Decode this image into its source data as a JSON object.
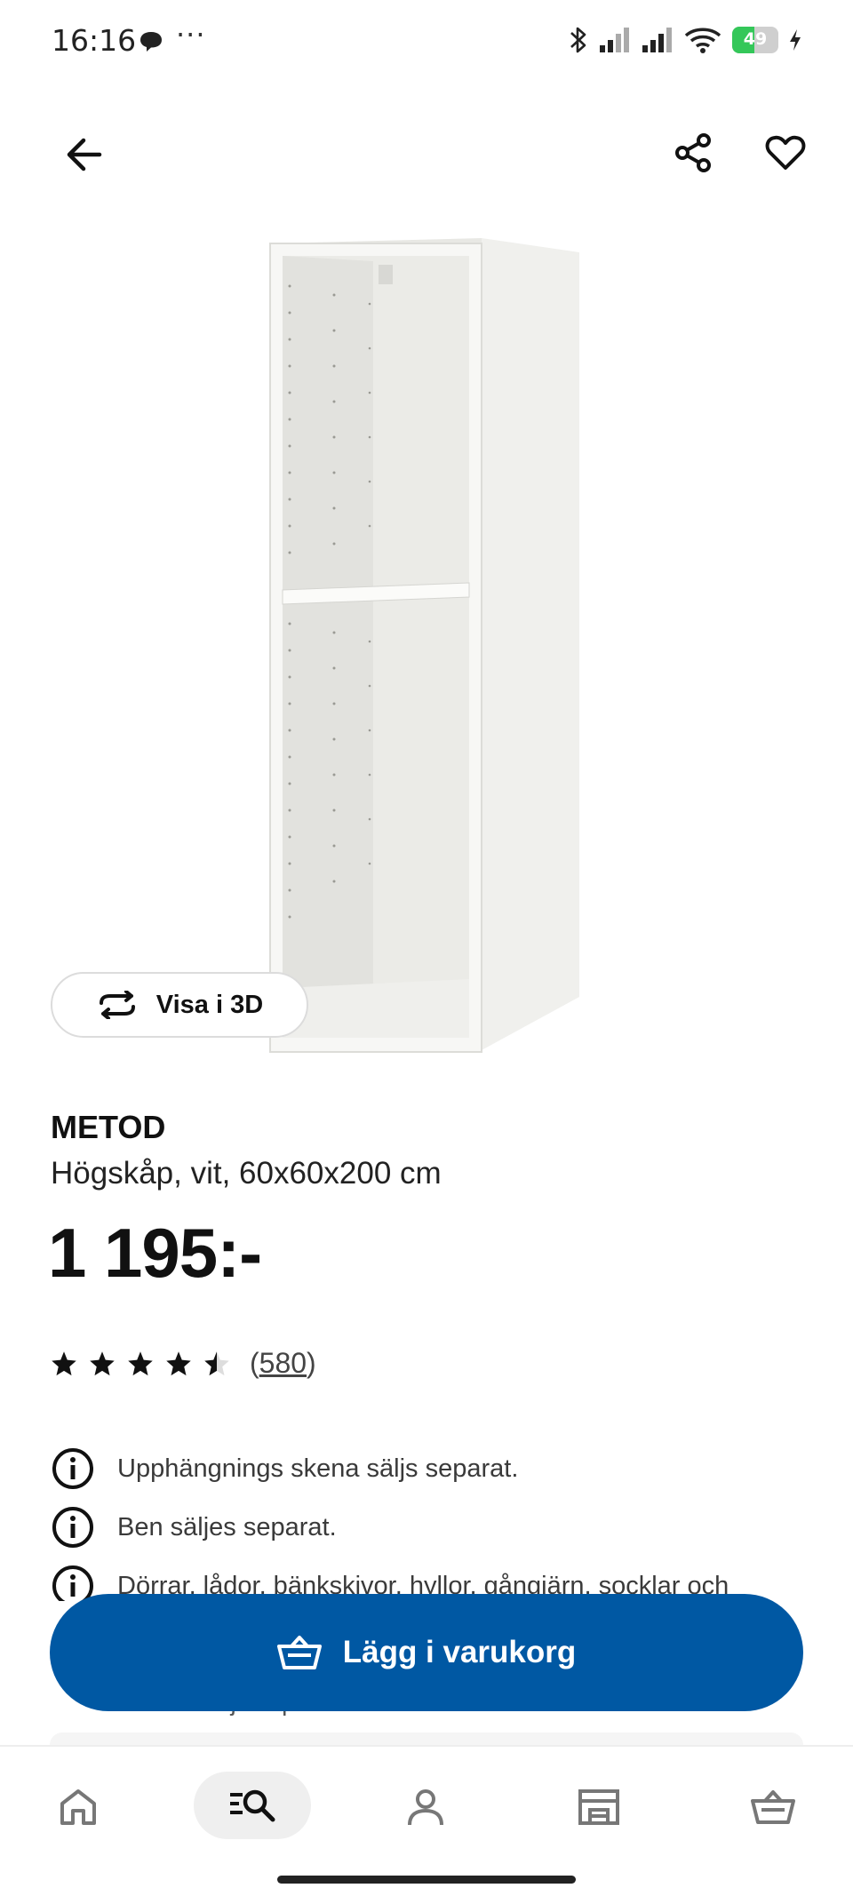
{
  "status_bar": {
    "time": "16:16",
    "dots": "···",
    "battery_level": "49",
    "battery_color": "#34c759"
  },
  "top_bar": {
    "back_icon": "arrow-left-icon",
    "share_icon": "share-icon",
    "favorite_icon": "heart-icon"
  },
  "product": {
    "view_3d_label": "Visa i 3D",
    "name": "METOD",
    "description": "Högskåp, vit, 60x60x200 cm",
    "price": "1 195:-",
    "rating": {
      "stars": 4.5,
      "out_of": 5,
      "count_open": "(",
      "count": "580",
      "count_close": ")"
    },
    "info_notes": [
      "Upphängnings skena säljs separat.",
      "Ben säljes separat.",
      "Dörrar, lådor, bänkskivor, hyllor, gångjärn, socklar och"
    ],
    "hidden_line": "...ljs separat."
  },
  "cta": {
    "add_to_cart_label": "Lägg i varukorg",
    "color": "#0058a3"
  },
  "bottom_nav": {
    "items": [
      {
        "icon": "home-icon"
      },
      {
        "icon": "search-icon",
        "active": true
      },
      {
        "icon": "profile-icon"
      },
      {
        "icon": "store-icon"
      },
      {
        "icon": "cart-icon"
      }
    ]
  }
}
